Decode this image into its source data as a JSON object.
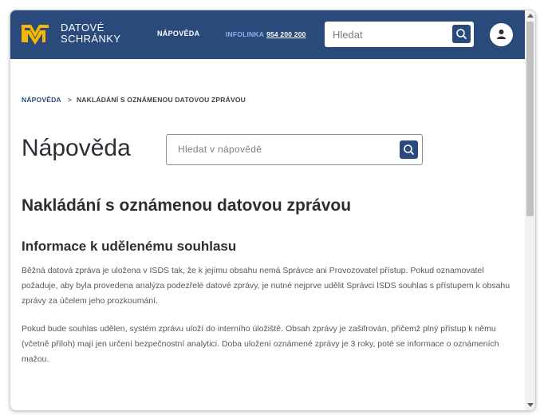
{
  "header": {
    "logo_line1": "DATOVÉ",
    "logo_line2": "SCHRÁNKY",
    "nav_help": "NÁPOVĚDA",
    "infolinka_label": "INFOLINKA",
    "infolinka_number": "954 200 200",
    "search_placeholder": "Hledat",
    "colors": {
      "bar": "#2a4a7c",
      "logo_yellow": "#f5b700",
      "infolinka": "#8fb3e6"
    },
    "icons": {
      "search": "search-icon",
      "user": "user-icon"
    }
  },
  "breadcrumb": {
    "home": "NÁPOVĚDA",
    "separator": ">",
    "current": "NAKLÁDÁNÍ S OZNÁMENOU DATOVOU ZPRÁVOU"
  },
  "main": {
    "page_title": "Nápověda",
    "search_placeholder": "Hledat v nápovědě",
    "article_title": "Nakládání s oznámenou datovou zprávou",
    "section_title": "Informace k udělenému souhlasu",
    "paragraphs": [
      "Běžná datová zpráva je uložena v ISDS tak, že k jejímu obsahu nemá Správce ani Provozovatel přístup. Pokud oznamovatel požaduje, aby byla provedena analýza podezřelé datové zprávy, je nutné nejprve udělit Správci ISDS souhlas s přístupem k obsahu zprávy za účelem jeho prozkoumání.",
      "Pokud bude souhlas udělen, systém zprávu uloží do interního úložiště. Obsah zprávy je zašifrován, přičemž plný přístup k němu (včetně příloh) mají jen určení bezpečnostní analytici. Doba uložení oznámené zprávy je 3 roky, poté se informace o oznámeních mažou."
    ]
  }
}
